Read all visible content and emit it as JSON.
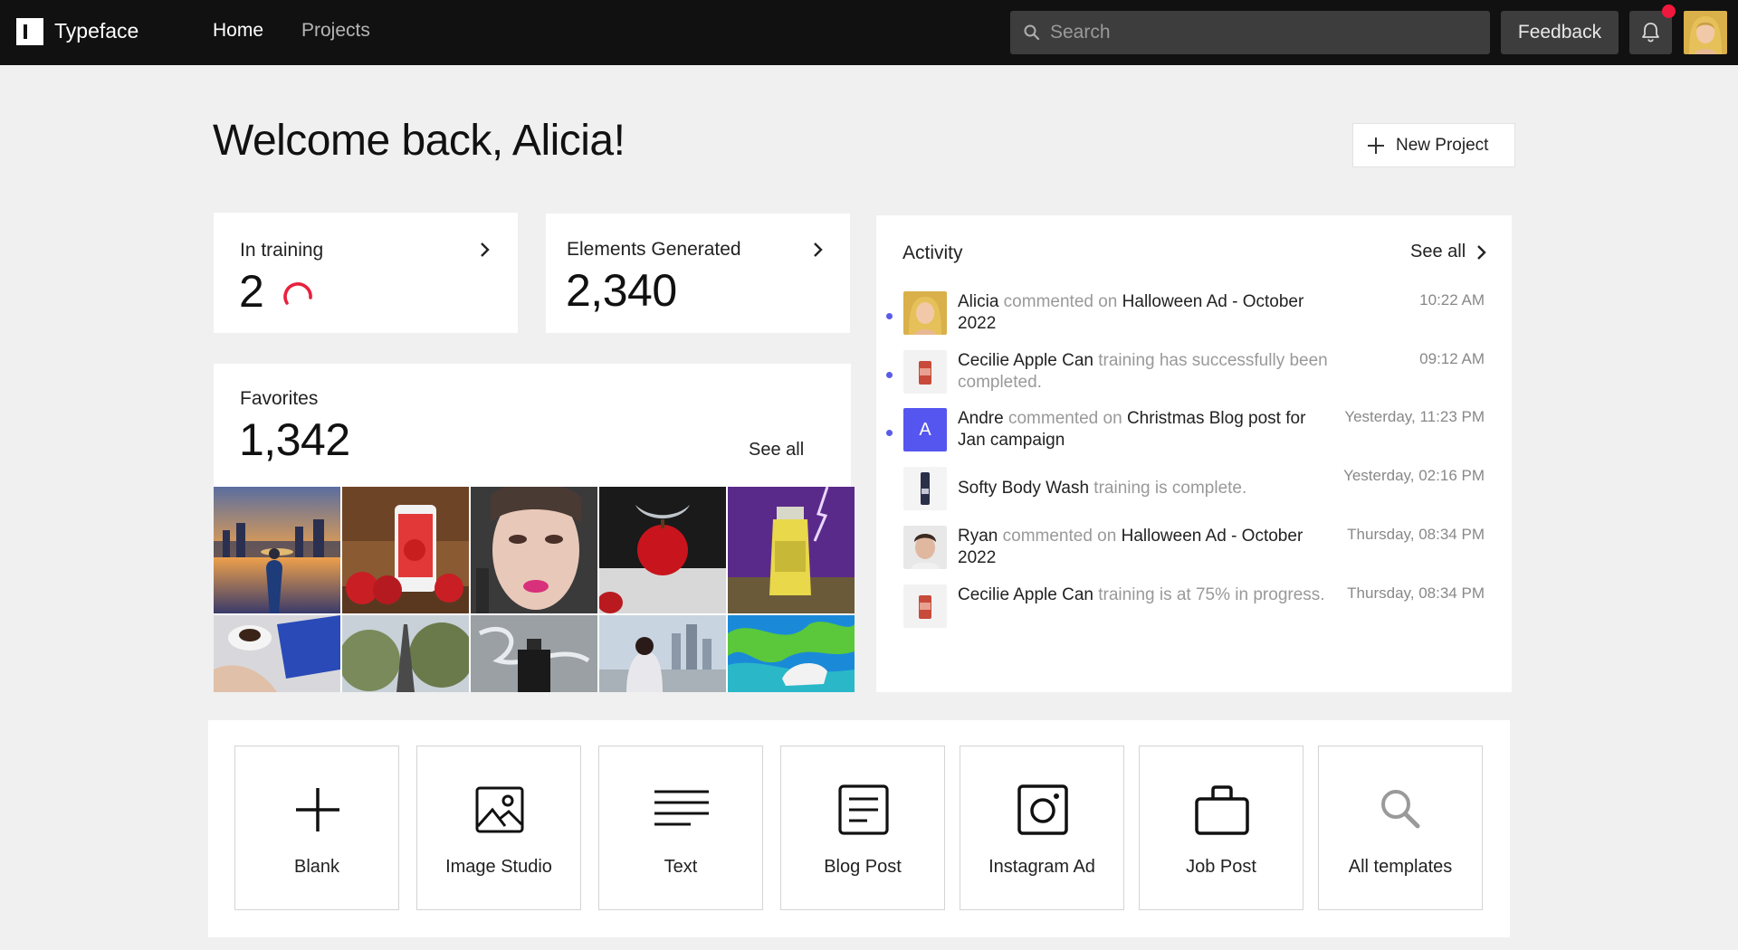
{
  "app": {
    "brand": "Typeface"
  },
  "nav": {
    "home": "Home",
    "projects": "Projects"
  },
  "search": {
    "placeholder": "Search",
    "value": ""
  },
  "header": {
    "feedback": "Feedback",
    "welcome": "Welcome back, Alicia!",
    "new_project": "New Project"
  },
  "stats": {
    "in_training": {
      "label": "In training",
      "value": "2"
    },
    "elements_generated": {
      "label": "Elements Generated",
      "value": "2,340"
    },
    "favorites": {
      "label": "Favorites",
      "value": "1,342",
      "see_all": "See all"
    }
  },
  "favorites_tiles": [
    "city-sunset-businessman",
    "apple-soda-can",
    "woman-face-cosmetics",
    "apple-splash",
    "yerba-mate-bottle",
    "",
    "laptop-coffee",
    "eiffel-tower",
    "perfume-splash",
    "woman-city-skyline",
    "paint-splash-sneaker",
    ""
  ],
  "activity": {
    "title": "Activity",
    "see_all": "See all",
    "items": [
      {
        "unread": true,
        "avatar": "alicia-avatar",
        "actor": "Alicia",
        "verb": " commented on ",
        "target": "Halloween Ad - October 2022",
        "tail": "",
        "time": "10:22 AM"
      },
      {
        "unread": true,
        "avatar": "cecilie-can-thumb",
        "actor": "Cecilie Apple Can",
        "verb": " training has successfully been completed.",
        "target": "",
        "tail": "",
        "time": "09:12 AM"
      },
      {
        "unread": true,
        "avatar": "letter-a-avatar",
        "letter": "A",
        "actor": "Andre",
        "verb": " commented on ",
        "target": "Christmas Blog post for Jan campaign",
        "tail": "",
        "time": "Yesterday, 11:23 PM"
      },
      {
        "unread": false,
        "avatar": "body-wash-thumb",
        "actor": "Softy Body Wash",
        "verb": " training is complete.",
        "target": "",
        "tail": "",
        "time": "Yesterday, 02:16 PM"
      },
      {
        "unread": false,
        "avatar": "ryan-avatar",
        "actor": "Ryan",
        "verb": " commented on ",
        "target": "Halloween Ad - October 2022",
        "tail": "",
        "time": "Thursday, 08:34 PM"
      },
      {
        "unread": false,
        "avatar": "cecilie-can-thumb",
        "actor": "Cecilie Apple Can",
        "verb": " training is at 75% in progress.",
        "target": "",
        "tail": "",
        "time": "Thursday, 08:34 PM"
      }
    ]
  },
  "templates": [
    {
      "label": "Blank",
      "icon": "plus-icon"
    },
    {
      "label": "Image Studio",
      "icon": "image-icon"
    },
    {
      "label": "Text",
      "icon": "text-lines-icon"
    },
    {
      "label": "Blog Post",
      "icon": "document-icon"
    },
    {
      "label": "Instagram Ad",
      "icon": "instagram-icon"
    },
    {
      "label": "Job Post",
      "icon": "briefcase-icon"
    },
    {
      "label": "All templates",
      "icon": "search-icon"
    }
  ],
  "colors": {
    "topbar": "#111111",
    "accent_dot": "#5b5be8",
    "notification": "#f0183c",
    "spinner": "#e8213d",
    "avatar_a": "#5555f0"
  }
}
